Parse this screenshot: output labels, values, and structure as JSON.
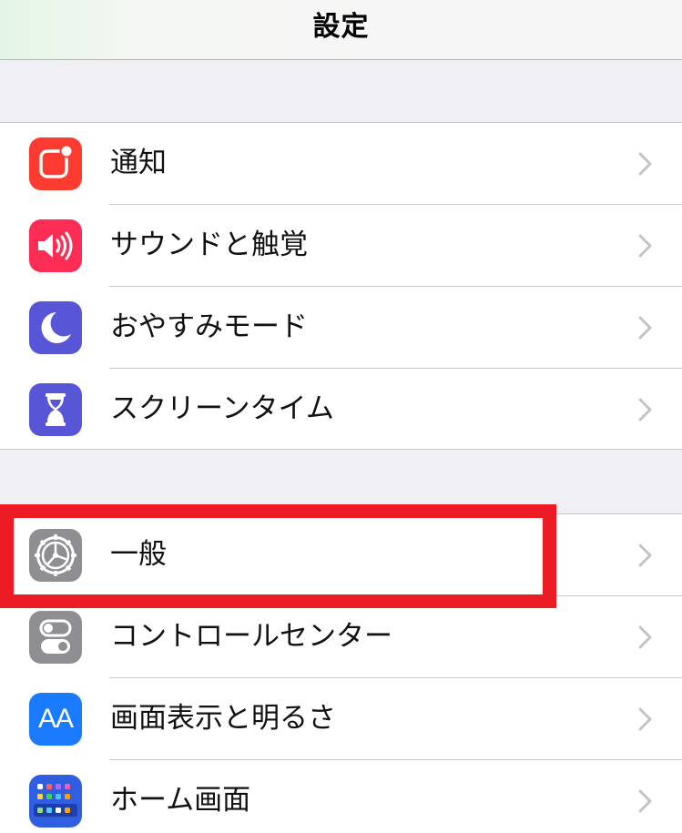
{
  "nav": {
    "title": "設定"
  },
  "group1": [
    {
      "label": "通知",
      "icon": "notifications-icon",
      "color": "#fe3b30"
    },
    {
      "label": "サウンドと触覚",
      "icon": "sound-icon",
      "color": "#fd2d55"
    },
    {
      "label": "おやすみモード",
      "icon": "moon-icon",
      "color": "#5856d6"
    },
    {
      "label": "スクリーンタイム",
      "icon": "hourglass-icon",
      "color": "#5856d6"
    }
  ],
  "group2": [
    {
      "label": "一般",
      "icon": "gear-icon",
      "color": "#8e8e93"
    },
    {
      "label": "コントロールセンター",
      "icon": "toggles-icon",
      "color": "#8e8e93"
    },
    {
      "label": "画面表示と明るさ",
      "icon": "display-aa-icon",
      "color": "#1a7bff",
      "glyph": "AA"
    },
    {
      "label": "ホーム画面",
      "icon": "home-screen-icon",
      "color": "#2f5fe0"
    }
  ],
  "highlight": {
    "color": "#ed1c24"
  }
}
